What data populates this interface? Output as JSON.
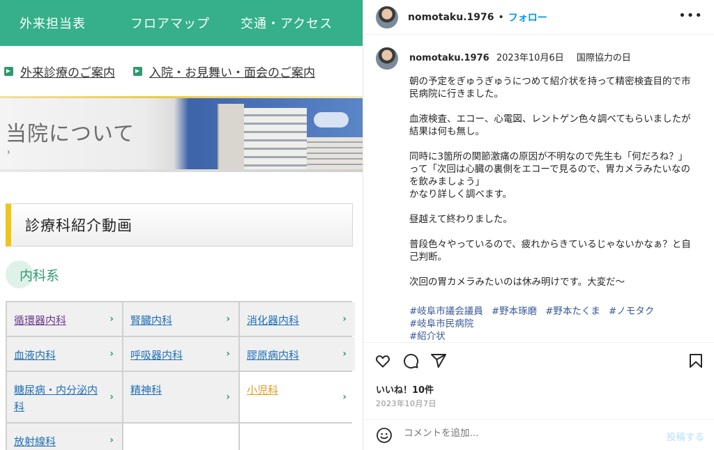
{
  "left": {
    "topnav": [
      "外来担当表",
      "フロアマップ",
      "交通・アクセス"
    ],
    "sublinks": [
      "外来診療のご案内",
      "入院・お見舞い・面会のご案内"
    ],
    "banner": {
      "title": "当院について",
      "chevron": "›"
    },
    "section_title": "診療科紹介動画",
    "subcategory": "内科系",
    "departments": [
      {
        "label": "循環器内科",
        "style": "visited"
      },
      {
        "label": "腎臓内科",
        "style": "link"
      },
      {
        "label": "消化器内科",
        "style": "link"
      },
      {
        "label": "血液内科",
        "style": "link"
      },
      {
        "label": "呼吸器内科",
        "style": "link"
      },
      {
        "label": "膠原病内科",
        "style": "link"
      },
      {
        "label": "糖尿病・内分泌内科",
        "style": "link"
      },
      {
        "label": "精神科",
        "style": "link"
      },
      {
        "label": "小児科",
        "style": "orange"
      },
      {
        "label": "放射線科",
        "style": "link"
      }
    ],
    "chevron_glyph": "›"
  },
  "post": {
    "username": "nomotaku.1976",
    "separator": "•",
    "follow_label": "フォロー",
    "more_label": "•••",
    "caption_date": "2023年10月6日",
    "caption_day": "国際協力の日",
    "paragraphs": [
      "朝の予定をぎゅうぎゅうにつめて紹介状を持って精密検査目的で市民病院に行きました。",
      "血液検査、エコー、心電図、レントゲン色々調べてもらいましたが結果は何も無し。",
      "同時に3箇所の関節激痛の原因が不明なので先生も「何だろね？」って「次回は心臓の裏側をエコーで見るので、胃カメラみたいなのを飲みましょう」\nかなり詳しく調べます。",
      "昼越えて終わりました。",
      "普段色々やっているので、疲れからきているじゃないかなぁ？と自己判断。",
      "次回の胃カメラみたいのは休み明けです。大変だ〜"
    ],
    "hashtags_line1": [
      "#岐阜市議会議員",
      "#野本琢磨",
      "#野本たくま",
      "#ノモタク"
    ],
    "hashtags_line2": [
      "#岐阜市民病院"
    ],
    "hashtags_line3": [
      "#紹介状"
    ],
    "likes": "いいね！10件",
    "post_date": "2023年10月7日",
    "comment_placeholder": "コメントを追加...",
    "post_button": "投稿する",
    "colors": {
      "link": "#0095f6",
      "hashtag": "#385898",
      "accent_green": "#35b08a",
      "section_bar": "#f0c419"
    },
    "icons": [
      "heart-icon",
      "comment-icon",
      "share-icon",
      "bookmark-icon",
      "emoji-icon"
    ]
  }
}
